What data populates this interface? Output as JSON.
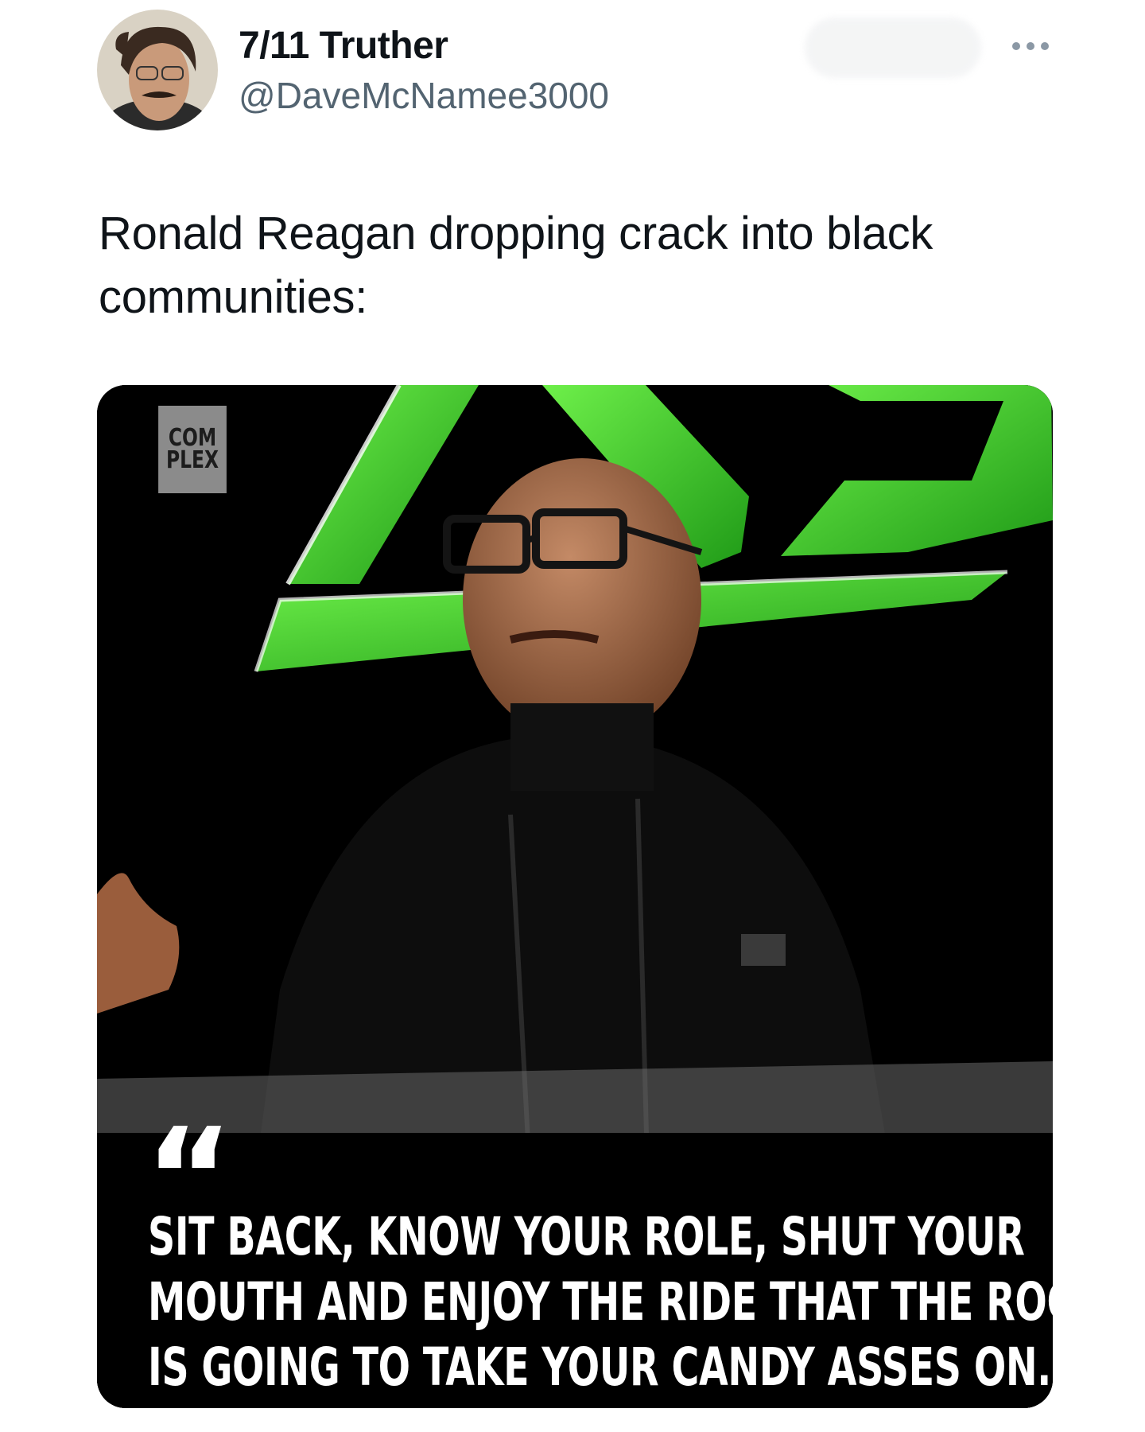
{
  "author": {
    "display_name": "7/11 Truther",
    "handle": "@DaveMcNamee3000",
    "avatar_icon": "profile-photo"
  },
  "actions": {
    "more_icon": "more-horizontal-icon"
  },
  "tweet": {
    "text": "Ronald Reagan dropping crack into black communities:"
  },
  "media": {
    "logo_text_line1": "COM",
    "logo_text_line2": "PLEX",
    "quote_mark": "“",
    "quote_lines": [
      "SIT BACK, KNOW YOUR ROLE, SHUT YOUR",
      "MOUTH AND ENJOY THE RIDE THAT THE ROCK",
      "IS GOING TO TAKE YOUR CANDY ASSES ON."
    ]
  },
  "colors": {
    "brand_green": "#3ccf2a",
    "text_primary": "#0f1419",
    "text_secondary": "#536471"
  }
}
